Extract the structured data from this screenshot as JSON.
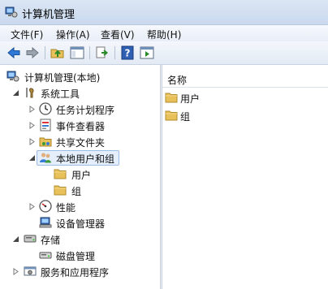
{
  "window": {
    "title": "计算机管理"
  },
  "menu": [
    {
      "label": "文件(F)"
    },
    {
      "label": "操作(A)"
    },
    {
      "label": "查看(V)"
    },
    {
      "label": "帮助(H)"
    }
  ],
  "toolbar": {
    "buttons": [
      "back-icon",
      "forward-icon",
      "up-folder-icon",
      "show-hide-tree-icon",
      "export-list-icon",
      "help-icon",
      "properties-icon"
    ]
  },
  "tree": {
    "root": "计算机管理(本地)",
    "system_tools": "系统工具",
    "task_scheduler": "任务计划程序",
    "event_viewer": "事件查看器",
    "shared_folders": "共享文件夹",
    "local_users_groups": "本地用户和组",
    "users": "用户",
    "groups": "组",
    "performance": "性能",
    "device_manager": "设备管理器",
    "storage": "存储",
    "disk_management": "磁盘管理",
    "services_apps": "服务和应用程序"
  },
  "list": {
    "column_name": "名称",
    "items": [
      {
        "label": "用户"
      },
      {
        "label": "组"
      }
    ]
  },
  "colors": {
    "folder": "#e8c15a",
    "selected_bg": "#e5eefb",
    "selected_border": "#9ebbe3"
  }
}
